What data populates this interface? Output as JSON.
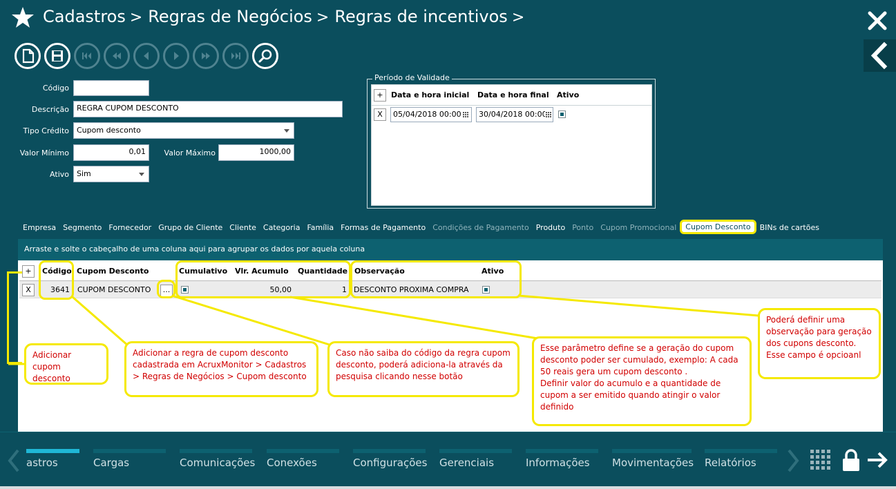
{
  "header": {
    "crumbs": [
      "Cadastros",
      "Regras de Negócios",
      "Regras de incentivos"
    ],
    "separator": ">"
  },
  "toolbar": {
    "buttons": [
      "new-icon",
      "save-icon",
      "first-icon",
      "rewind-icon",
      "prev-icon",
      "next-icon",
      "forward-icon",
      "last-icon",
      "search-icon"
    ]
  },
  "form": {
    "codigo_label": "Código",
    "codigo_value": "",
    "descricao_label": "Descrição",
    "descricao_value": "REGRA CUPOM DESCONTO",
    "tipo_label": "Tipo Crédito",
    "tipo_value": "Cupom desconto",
    "valor_min_label": "Valor Mínimo",
    "valor_min_value": "0,01",
    "valor_max_label": "Valor Máximo",
    "valor_max_value": "1000,00",
    "ativo_label": "Ativo",
    "ativo_value": "Sim"
  },
  "validity": {
    "title": "Período de Validade",
    "add": "+",
    "headers": [
      "Data e hora inicial",
      "Data e hora final",
      "Ativo"
    ],
    "row": {
      "del": "X",
      "start": "05/04/2018 00:00",
      "end": "30/04/2018 00:00",
      "active": true
    }
  },
  "tabs": [
    {
      "label": "Empresa",
      "state": "normal"
    },
    {
      "label": "Segmento",
      "state": "normal"
    },
    {
      "label": "Fornecedor",
      "state": "normal"
    },
    {
      "label": "Grupo de Cliente",
      "state": "normal"
    },
    {
      "label": "Cliente",
      "state": "normal"
    },
    {
      "label": "Categoria",
      "state": "normal"
    },
    {
      "label": "Família",
      "state": "normal"
    },
    {
      "label": "Formas de Pagamento",
      "state": "normal"
    },
    {
      "label": "Condições de Pagamento",
      "state": "dim"
    },
    {
      "label": "Produto",
      "state": "normal"
    },
    {
      "label": "Ponto",
      "state": "dim"
    },
    {
      "label": "Cupom Promocional",
      "state": "dim"
    },
    {
      "label": "Cupom Desconto",
      "state": "active"
    },
    {
      "label": "BINs de cartões",
      "state": "normal"
    }
  ],
  "grid": {
    "group_hint": "Arraste e solte o cabeçalho de uma coluna aqui para agrupar os dados por aquela coluna",
    "add": "+",
    "headers": {
      "codigo": "Código",
      "cupom": "Cupom Desconto",
      "cumulativo": "Cumulativo",
      "vlr": "Vlr. Acumulo",
      "qtd": "Quantidade",
      "obs": "Observação",
      "ativo": "Ativo"
    },
    "row": {
      "del": "X",
      "codigo": "3641",
      "cupom": "CUPOM DESCONTO",
      "lookup": "...",
      "cumulativo": true,
      "vlr": "50,00",
      "qtd": "1",
      "obs": "DESCONTO PROXIMA COMPRA",
      "ativo": true
    }
  },
  "notes": {
    "add": "Adicionar cupom desconto",
    "rule": "Adicionar a regra de cupom desconto cadastrada em AcruxMonitor > Cadastros > Regras de Negócios > Cupom desconto",
    "search": "Caso não saiba do código da regra cupom desconto, poderá adiciona-la através da pesquisa clicando nesse botão",
    "param": "Esse parâmetro define se a geração do cupom desconto poder ser cumulado, exemplo: A cada 50 reais gera um cupom desconto .\nDefinir valor do acumulo e a quantidade de cupom a ser emitido quando atingir o valor definido",
    "obs": "Poderá definir uma observação para geração dos cupons desconto. Esse campo é opcioanl"
  },
  "bottom_nav": {
    "items": [
      {
        "label": "astros",
        "active": true
      },
      {
        "label": "Cargas",
        "active": false
      },
      {
        "label": "Comunicações",
        "active": false
      },
      {
        "label": "Conexões",
        "active": false
      },
      {
        "label": "Configurações",
        "active": false
      },
      {
        "label": "Gerenciais",
        "active": false
      },
      {
        "label": "Informações",
        "active": false
      },
      {
        "label": "Movimentações",
        "active": false
      },
      {
        "label": "Relatórios",
        "active": false
      }
    ]
  },
  "colors": {
    "background": "#0b4e5d",
    "accent": "#0d6170",
    "highlight": "#f5e900",
    "note_text": "#d10000"
  }
}
